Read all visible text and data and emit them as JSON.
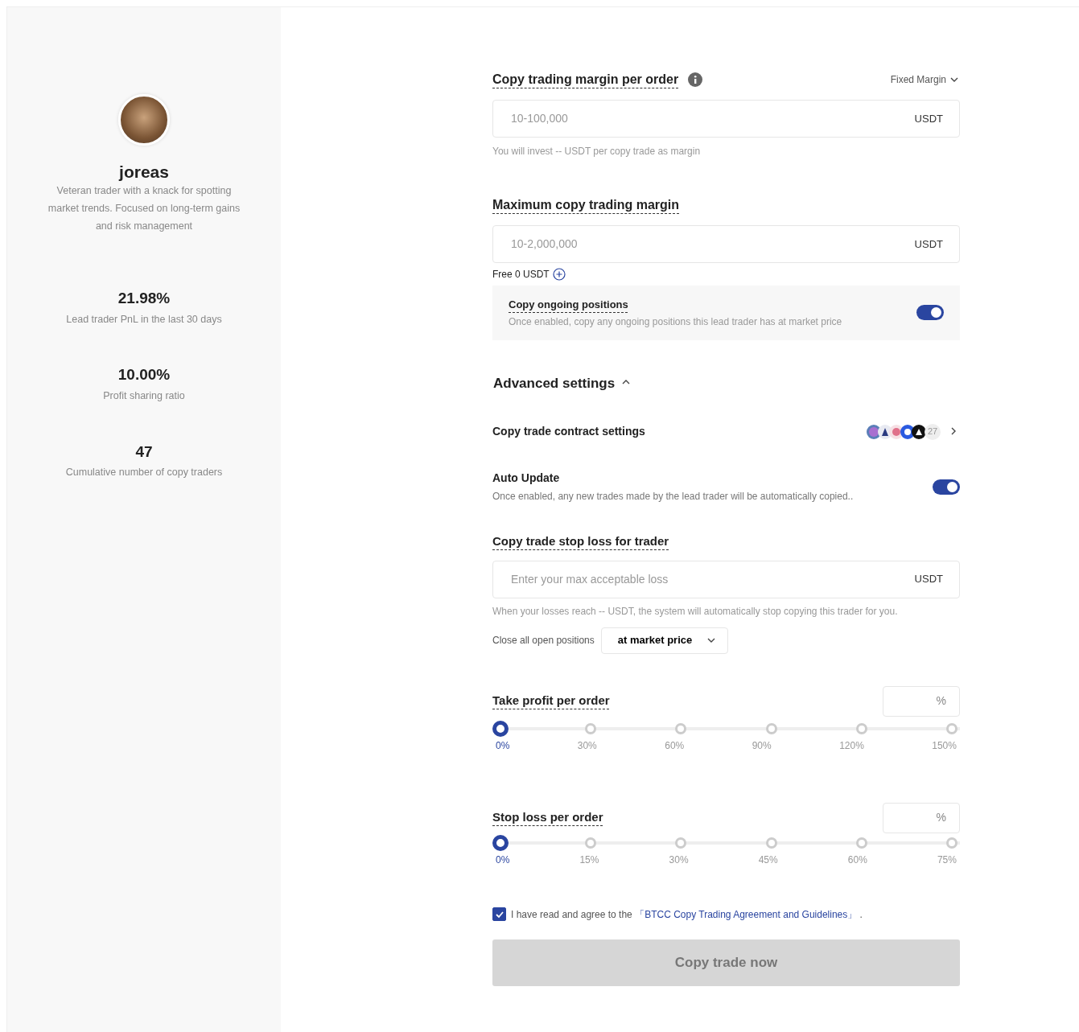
{
  "trader": {
    "name": "joreas",
    "bio": "Veteran trader with a knack for spotting market trends. Focused on long-term gains and risk management",
    "stats": [
      {
        "value": "21.98%",
        "label": "Lead trader PnL in the last 30 days"
      },
      {
        "value": "10.00%",
        "label": "Profit sharing ratio"
      },
      {
        "value": "47",
        "label": "Cumulative number of copy traders"
      }
    ]
  },
  "margin_per_order": {
    "title": "Copy trading margin per order",
    "mode": "Fixed Margin",
    "placeholder": "10-100,000",
    "unit": "USDT",
    "hint": "You will invest -- USDT per copy trade as margin"
  },
  "max_margin": {
    "title": "Maximum copy trading margin",
    "placeholder": "10-2,000,000",
    "unit": "USDT",
    "free": "Free 0 USDT"
  },
  "copy_ongoing": {
    "title": "Copy ongoing positions",
    "description": "Once enabled, copy any ongoing positions this lead trader has at market price",
    "on": true
  },
  "advanced": {
    "title": "Advanced settings",
    "expanded": true,
    "contract_settings": {
      "title": "Copy trade contract settings",
      "count": "27"
    },
    "auto_update": {
      "title": "Auto Update",
      "description": "Once enabled, any new trades made by the lead trader will be automatically copied..",
      "on": true
    },
    "stop_loss_trader": {
      "title": "Copy trade stop loss for trader",
      "placeholder": "Enter your max acceptable loss",
      "unit": "USDT",
      "hint": "When your losses reach -- USDT, the system will automatically stop copying this trader for you.",
      "close_label": "Close all open positions",
      "close_mode": "at market price"
    },
    "sliders": [
      {
        "title": "Take profit per order",
        "unit": "%",
        "level": 0,
        "marks": [
          "0%",
          "30%",
          "60%",
          "90%",
          "120%",
          "150%"
        ]
      },
      {
        "title": "Stop loss per order",
        "unit": "%",
        "level": 0,
        "marks": [
          "0%",
          "15%",
          "30%",
          "45%",
          "60%",
          "75%"
        ]
      }
    ]
  },
  "agreement": {
    "checked": true,
    "text": "I have read and agree to the",
    "link": "「BTCC Copy Trading Agreement and Guidelines」",
    "end": "."
  },
  "submit": {
    "label": "Copy trade now",
    "disabled": true
  }
}
